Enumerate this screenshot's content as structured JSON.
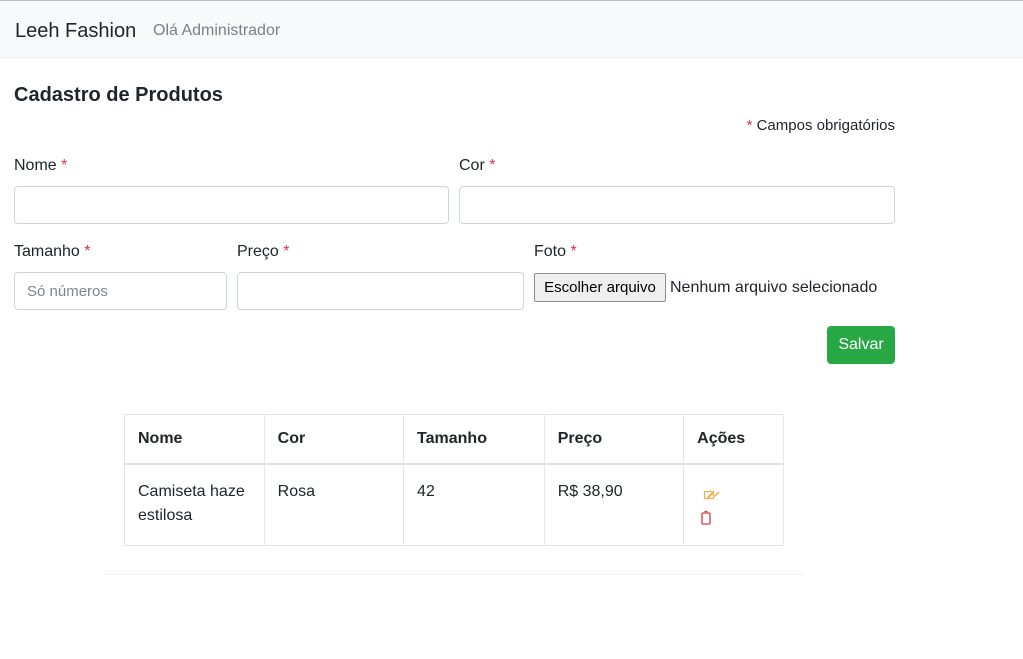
{
  "navbar": {
    "brand": "Leeh Fashion",
    "greeting": "Olá Administrador"
  },
  "form": {
    "title": "Cadastro de Produtos",
    "required_mark": "*",
    "required_note": "Campos obrigatórios",
    "fields": {
      "nome": {
        "label": "Nome",
        "value": "",
        "placeholder": ""
      },
      "cor": {
        "label": "Cor",
        "value": "",
        "placeholder": ""
      },
      "tamanho": {
        "label": "Tamanho",
        "value": "",
        "placeholder": "Só números"
      },
      "preco": {
        "label": "Preço",
        "value": "",
        "placeholder": ""
      },
      "foto": {
        "label": "Foto",
        "button_label": "Escolher arquivo",
        "status": "Nenhum arquivo selecionado"
      }
    },
    "save_label": "Salvar"
  },
  "table": {
    "headers": [
      "Nome",
      "Cor",
      "Tamanho",
      "Preço",
      "Ações"
    ],
    "rows": [
      {
        "nome": "Camiseta haze estilosa",
        "cor": "Rosa",
        "tamanho": "42",
        "preco": "R$ 38,90"
      }
    ]
  },
  "icons": {
    "edit": "edit-icon",
    "delete": "trash-icon"
  },
  "colors": {
    "required": "#dc3545",
    "save_button": "#28a745",
    "edit_icon": "#f0ad4e",
    "delete_icon": "#dc3545",
    "navbar_bg": "#f8f9fa"
  }
}
